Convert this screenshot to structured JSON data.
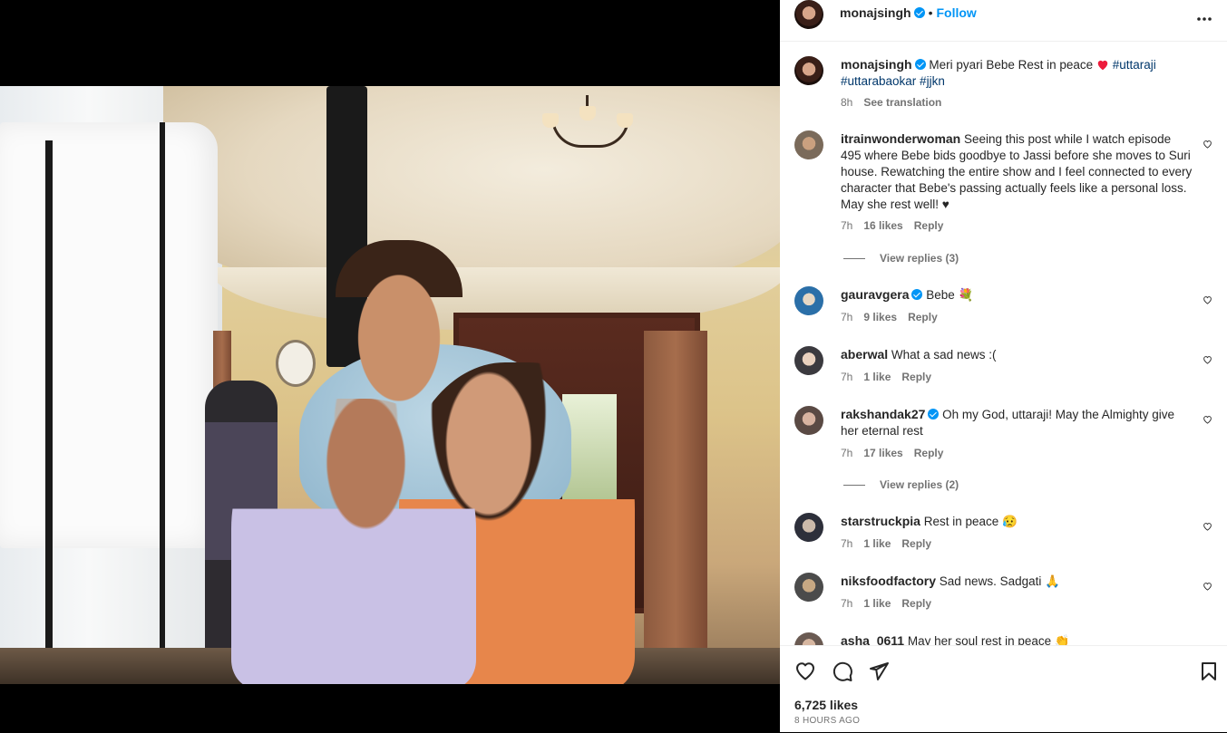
{
  "post": {
    "username": "monajsingh",
    "follow_label": "Follow",
    "separator": "•",
    "more_label": "•••"
  },
  "caption": {
    "username": "monajsingh",
    "text": "Meri pyari Bebe Rest in peace",
    "hashtags_line1": "#uttaraji",
    "hashtags_line2": "#uttarabaokar #jjkn",
    "time": "8h",
    "see_translation": "See translation"
  },
  "comments": [
    {
      "username": "itrainwonderwoman",
      "text": "Seeing this post while I watch episode 495 where Bebe bids goodbye to Jassi before she moves to Suri house. Rewatching the entire show and I feel connected to every character that Bebe's passing actually feels like a personal loss. May she rest well! ♥",
      "time": "7h",
      "likes": "16 likes",
      "reply": "Reply",
      "view_replies": "View replies (3)"
    },
    {
      "username": "gauravgera",
      "text": "Bebe 💐",
      "time": "7h",
      "likes": "9 likes",
      "reply": "Reply"
    },
    {
      "username": "aberwal",
      "text": "What a sad news :(",
      "time": "7h",
      "likes": "1 like",
      "reply": "Reply"
    },
    {
      "username": "rakshandak27",
      "text": "Oh my God, uttaraji! May the Almighty give her eternal rest",
      "time": "7h",
      "likes": "17 likes",
      "reply": "Reply",
      "view_replies": "View replies (2)"
    },
    {
      "username": "starstruckpia",
      "text": "Rest in peace 😥",
      "time": "7h",
      "likes": "1 like",
      "reply": "Reply"
    },
    {
      "username": "niksfoodfactory",
      "text": "Sad news. Sadgati 🙏",
      "time": "7h",
      "likes": "1 like",
      "reply": "Reply"
    },
    {
      "username": "asha_0611",
      "text": "May her soul rest in peace 👏"
    }
  ],
  "footer": {
    "likes": "6,725 likes",
    "time": "8 HOURS AGO"
  }
}
